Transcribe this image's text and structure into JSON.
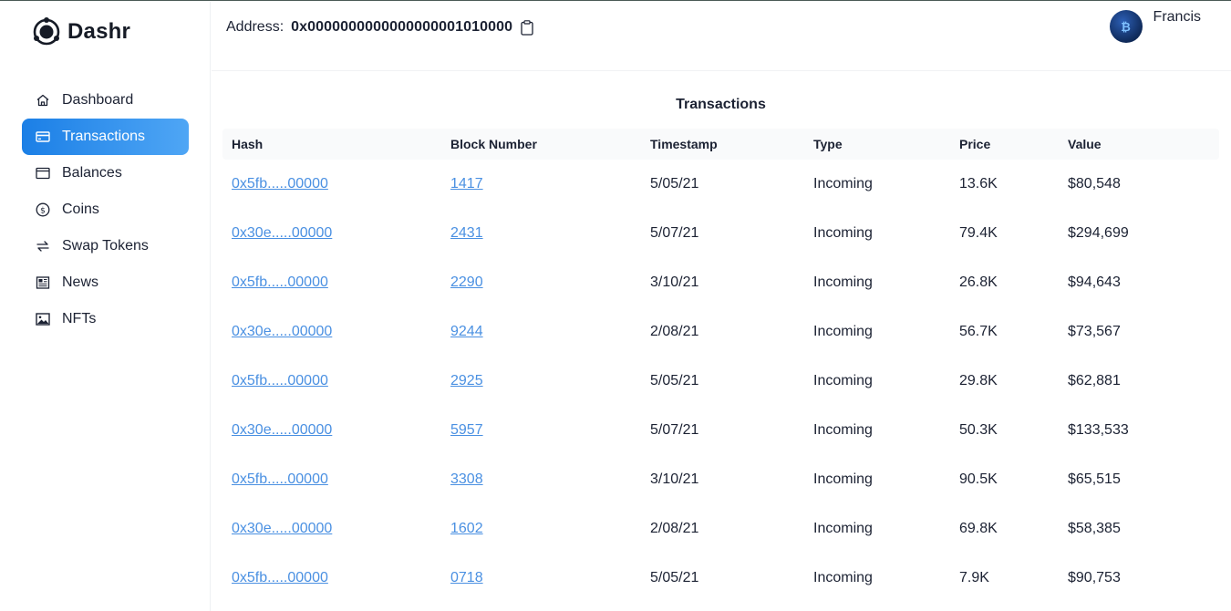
{
  "brand": {
    "name": "Dashr"
  },
  "sidebar": {
    "items": [
      {
        "label": "Dashboard",
        "icon": "home-icon",
        "active": false
      },
      {
        "label": "Transactions",
        "icon": "credit-card-icon",
        "active": true
      },
      {
        "label": "Balances",
        "icon": "wallet-icon",
        "active": false
      },
      {
        "label": "Coins",
        "icon": "dollar-coin-icon",
        "active": false
      },
      {
        "label": "Swap Tokens",
        "icon": "swap-icon",
        "active": false
      },
      {
        "label": "News",
        "icon": "newspaper-icon",
        "active": false
      },
      {
        "label": "NFTs",
        "icon": "image-icon",
        "active": false
      }
    ]
  },
  "header": {
    "address_label": "Address:",
    "address_value": "0x0000000000000000001010000",
    "user_name": "Francis",
    "avatar_text": "₿"
  },
  "table": {
    "title": "Transactions",
    "columns": [
      "Hash",
      "Block Number",
      "Timestamp",
      "Type",
      "Price",
      "Value"
    ],
    "rows": [
      {
        "hash": "0x5fb.....00000",
        "block": "1417",
        "timestamp": "5/05/21",
        "type": "Incoming",
        "price": "13.6K",
        "value": "$80,548"
      },
      {
        "hash": "0x30e.....00000",
        "block": "2431",
        "timestamp": "5/07/21",
        "type": "Incoming",
        "price": "79.4K",
        "value": "$294,699"
      },
      {
        "hash": "0x5fb.....00000",
        "block": "2290",
        "timestamp": "3/10/21",
        "type": "Incoming",
        "price": "26.8K",
        "value": "$94,643"
      },
      {
        "hash": "0x30e.....00000",
        "block": "9244",
        "timestamp": "2/08/21",
        "type": "Incoming",
        "price": "56.7K",
        "value": "$73,567"
      },
      {
        "hash": "0x5fb.....00000",
        "block": "2925",
        "timestamp": "5/05/21",
        "type": "Incoming",
        "price": "29.8K",
        "value": "$62,881"
      },
      {
        "hash": "0x30e.....00000",
        "block": "5957",
        "timestamp": "5/07/21",
        "type": "Incoming",
        "price": "50.3K",
        "value": "$133,533"
      },
      {
        "hash": "0x5fb.....00000",
        "block": "3308",
        "timestamp": "3/10/21",
        "type": "Incoming",
        "price": "90.5K",
        "value": "$65,515"
      },
      {
        "hash": "0x30e.....00000",
        "block": "1602",
        "timestamp": "2/08/21",
        "type": "Incoming",
        "price": "69.8K",
        "value": "$58,385"
      },
      {
        "hash": "0x5fb.....00000",
        "block": "0718",
        "timestamp": "5/05/21",
        "type": "Incoming",
        "price": "7.9K",
        "value": "$90,753"
      }
    ]
  },
  "colors": {
    "accent_start": "#1b7fe6",
    "accent_end": "#4fa6f5",
    "link": "#4a90e2",
    "text": "#1c2233"
  }
}
